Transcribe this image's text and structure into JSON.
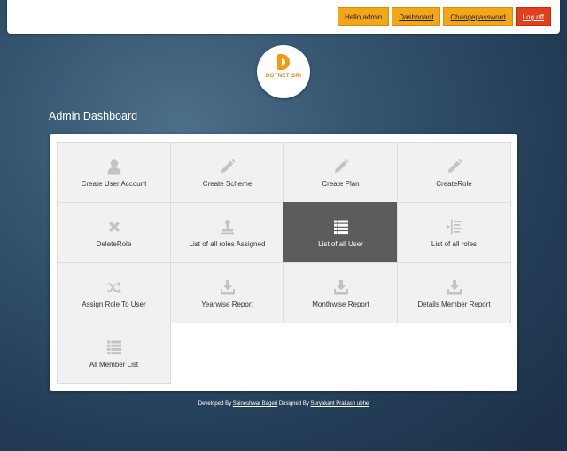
{
  "header": {
    "greeting": "Hello,admin",
    "dashboard_link": "Dashboard",
    "change_password_link": "Changepassword",
    "logoff_button": "Log off"
  },
  "colors": {
    "nav_button": "#f2a719",
    "logoff_button": "#e2401c",
    "active_tile": "#5c5c5c",
    "tile": "#f1f1f1"
  },
  "logo": {
    "text": "DOTNET SRI"
  },
  "page_title": "Admin Dashboard",
  "tiles": [
    {
      "label": "Create User Account",
      "icon": "user-icon"
    },
    {
      "label": "Create Scheme",
      "icon": "pencil-icon"
    },
    {
      "label": "Create Plan",
      "icon": "pencil-icon"
    },
    {
      "label": "CreateRole",
      "icon": "pencil-icon"
    },
    {
      "label": "DeleteRole",
      "icon": "close-icon"
    },
    {
      "label": "List of all roles Assigned",
      "icon": "stamp-icon"
    },
    {
      "label": "List of all User",
      "icon": "list-icon",
      "active": true
    },
    {
      "label": "List of all roles",
      "icon": "indent-list-icon"
    },
    {
      "label": "Assign Role To User",
      "icon": "shuffle-icon"
    },
    {
      "label": "Yearwise Report",
      "icon": "download-icon"
    },
    {
      "label": "Monthwise Report",
      "icon": "download-icon"
    },
    {
      "label": "Details Member Report",
      "icon": "download-icon"
    },
    {
      "label": "All Member List",
      "icon": "list-icon"
    }
  ],
  "footer": {
    "developed_by": "Developed By",
    "developer": "Saineshwar Bageri",
    "designed_by": "Designed By",
    "designer": "Suryakant Prakash ubhe"
  }
}
